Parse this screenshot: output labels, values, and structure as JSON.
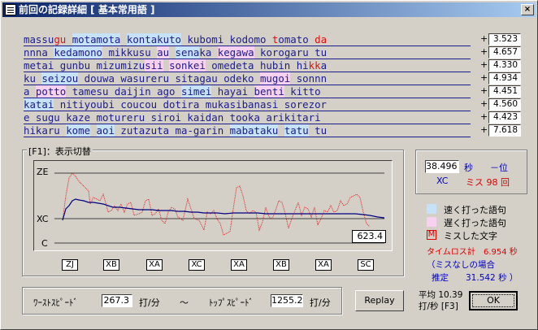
{
  "window": {
    "title": "前回の記録詳細 [ 基本常用語 ]",
    "close_glyph": "×"
  },
  "lines": [
    {
      "segs": [
        [
          "massu",
          ""
        ],
        [
          "gu",
          "r"
        ],
        [
          " ",
          ""
        ],
        [
          "motamota",
          "b"
        ],
        [
          " ",
          ""
        ],
        [
          "kontakuto",
          "b"
        ],
        [
          " kubomi kodomo ",
          ""
        ],
        [
          "t",
          "r"
        ],
        [
          "omato ",
          ""
        ],
        [
          "da",
          "r"
        ]
      ],
      "score": "3.523"
    },
    {
      "segs": [
        [
          "nnna ",
          ""
        ],
        [
          "kedamono",
          "b"
        ],
        [
          " mikkusu ",
          ""
        ],
        [
          "au",
          "p"
        ],
        [
          " ",
          ""
        ],
        [
          "sena",
          "b"
        ],
        [
          "ka",
          ""
        ],
        [
          " ",
          ""
        ],
        [
          "kegawa",
          "p"
        ],
        [
          " korogaru tu",
          ""
        ]
      ],
      "score": "4.657"
    },
    {
      "segs": [
        [
          "metai gunbu mizumizu",
          ""
        ],
        [
          "sii",
          "p"
        ],
        [
          " ",
          ""
        ],
        [
          "sonkei",
          "p"
        ],
        [
          " omedeta hubin hi",
          ""
        ],
        [
          "kk",
          "r"
        ],
        [
          "a",
          ""
        ]
      ],
      "score": "4.330"
    },
    {
      "segs": [
        [
          "ku ",
          ""
        ],
        [
          "seizou",
          "b"
        ],
        [
          " douwa wasureru sitagau odeko ",
          ""
        ],
        [
          "mugoi",
          "p"
        ],
        [
          " sonnn",
          ""
        ]
      ],
      "score": "4.934"
    },
    {
      "segs": [
        [
          "a ",
          ""
        ],
        [
          "potto",
          "p"
        ],
        [
          " tamesu daijin ago ",
          ""
        ],
        [
          "simei",
          "b"
        ],
        [
          " hayai ",
          ""
        ],
        [
          "benti",
          "p"
        ],
        [
          " kitto",
          ""
        ]
      ],
      "score": "4.451"
    },
    {
      "segs": [
        [
          "katai",
          "b"
        ],
        [
          " nitiyoubi coucou dotira mukasibanasi sorezor",
          ""
        ]
      ],
      "score": "4.560"
    },
    {
      "segs": [
        [
          "e sugu kaze motureru siroi kaidan tooka arikitari",
          ""
        ]
      ],
      "score": "4.423"
    },
    {
      "segs": [
        [
          "hikaru ",
          ""
        ],
        [
          "kome",
          "b"
        ],
        [
          " ",
          ""
        ],
        [
          "aoi",
          "b"
        ],
        [
          " zutazuta ma-garin ",
          ""
        ],
        [
          "mabataku",
          "b"
        ],
        [
          " ",
          ""
        ],
        [
          "tatu",
          "b"
        ],
        [
          " tu",
          ""
        ]
      ],
      "score": "7.618"
    }
  ],
  "plot": {
    "group_label": "[F1]：表示切替",
    "y_labels": [
      "ZE",
      "XC",
      "C"
    ],
    "value_label": "623.4",
    "tags": [
      "ZJ",
      "XB",
      "XA",
      "XC",
      "XA",
      "XB",
      "XA",
      "SC"
    ]
  },
  "stats": {
    "time_value": "38.496",
    "time_unit": "秒",
    "rank": "－位",
    "level_code": "XC",
    "miss_text": "ミス 98 回",
    "legend_fast": "速く打った語句",
    "legend_slow": "遅く打った語句",
    "legend_miss_mark": "M",
    "legend_miss": "ミスした文字",
    "timeloss_label": "タイムロス",
    "timeloss_value": "計　6.954 秒",
    "nomiss_label": "（ミスなしの場合",
    "nomiss_est": "推定　　31.542 秒 ）"
  },
  "speed": {
    "worst_label": "ﾜｰｽﾄｽﾋﾟｰﾄﾞ",
    "worst_value": "267.3",
    "unit": "打/分",
    "tilde": "～",
    "top_label": "ﾄｯﾌﾟｽﾋﾟｰﾄﾞ",
    "top_value": "1255.2",
    "unit2": "打/分"
  },
  "buttons": {
    "replay": "Replay",
    "ok": "OK"
  },
  "average": {
    "line1": "平均 10.39",
    "line2": "打/秒 [F3]"
  },
  "colors": {
    "fast": "#c6e2f8",
    "slow": "#f8d0f0",
    "miss": "#e01010",
    "text": "#1c1c8c"
  }
}
